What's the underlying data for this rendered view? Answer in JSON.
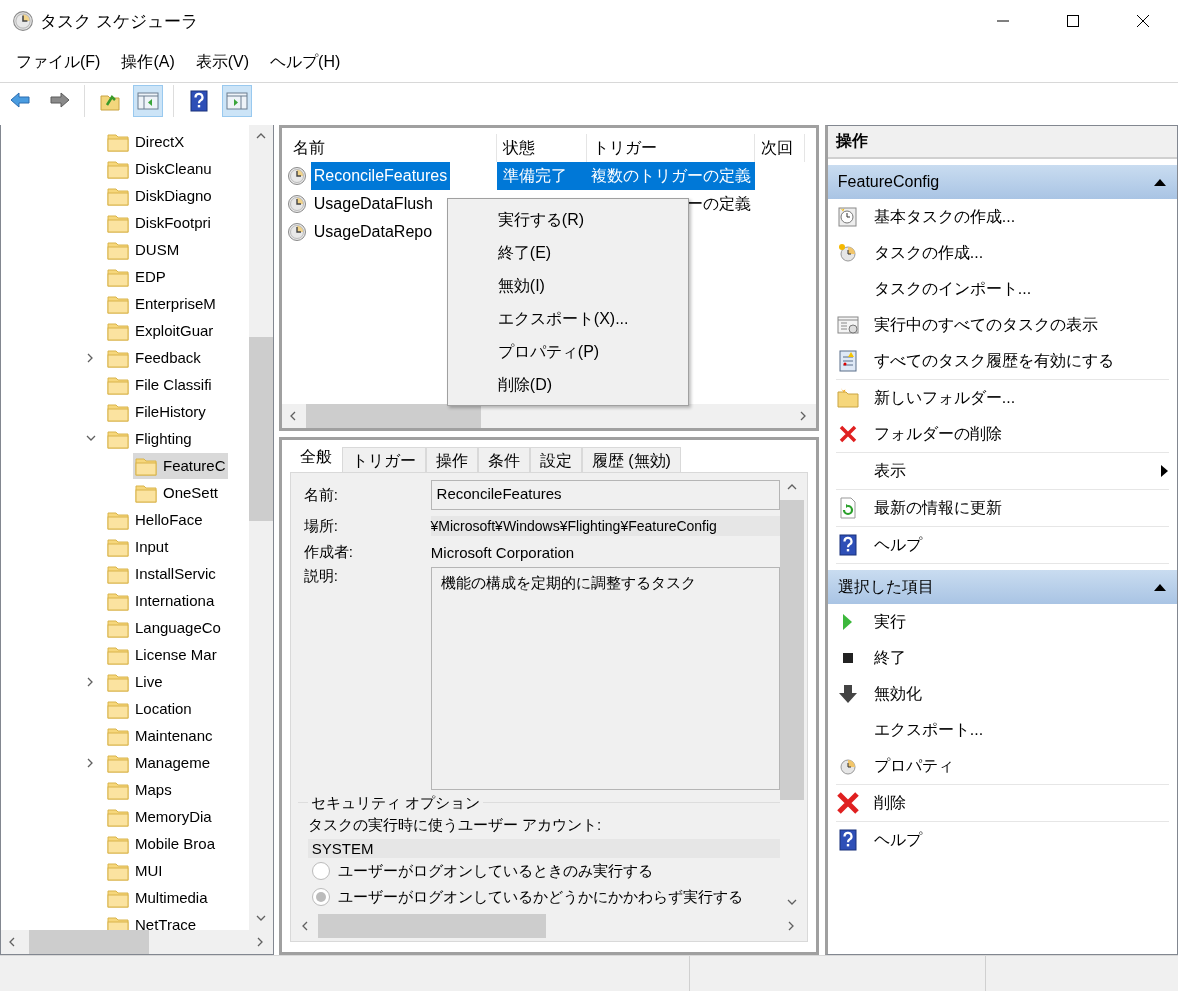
{
  "window": {
    "title": "タスク スケジューラ"
  },
  "menu": [
    "ファイル(F)",
    "操作(A)",
    "表示(V)",
    "ヘルプ(H)"
  ],
  "toolbar": [
    [
      {
        "kind": "back",
        "pressed": false
      },
      {
        "kind": "forward",
        "pressed": false
      }
    ],
    [
      {
        "kind": "up",
        "pressed": false
      },
      {
        "kind": "tree",
        "pressed": true
      }
    ],
    [
      {
        "kind": "help",
        "pressed": false
      },
      {
        "kind": "actions",
        "pressed": true
      }
    ]
  ],
  "tree": [
    {
      "label": "DirectX",
      "expandable": false,
      "expanded": false,
      "selected": false
    },
    {
      "label": "DiskCleanu",
      "expandable": false,
      "expanded": false,
      "selected": false
    },
    {
      "label": "DiskDiagno",
      "expandable": false,
      "expanded": false,
      "selected": false
    },
    {
      "label": "DiskFootpri",
      "expandable": false,
      "expanded": false,
      "selected": false
    },
    {
      "label": "DUSM",
      "expandable": false,
      "expanded": false,
      "selected": false
    },
    {
      "label": "EDP",
      "expandable": false,
      "expanded": false,
      "selected": false
    },
    {
      "label": "EnterpriseM",
      "expandable": false,
      "expanded": false,
      "selected": false
    },
    {
      "label": "ExploitGuar",
      "expandable": false,
      "expanded": false,
      "selected": false
    },
    {
      "label": "Feedback",
      "expandable": true,
      "expanded": false,
      "selected": false
    },
    {
      "label": "File Classifi",
      "expandable": false,
      "expanded": false,
      "selected": false
    },
    {
      "label": "FileHistory",
      "expandable": false,
      "expanded": false,
      "selected": false
    },
    {
      "label": "Flighting",
      "expandable": true,
      "expanded": true,
      "selected": false,
      "children": [
        {
          "label": "FeatureC",
          "expandable": false,
          "expanded": false,
          "selected": true
        },
        {
          "label": "OneSett",
          "expandable": false,
          "expanded": false,
          "selected": false
        }
      ]
    },
    {
      "label": "HelloFace",
      "expandable": false,
      "expanded": false,
      "selected": false
    },
    {
      "label": "Input",
      "expandable": false,
      "expanded": false,
      "selected": false
    },
    {
      "label": "InstallServic",
      "expandable": false,
      "expanded": false,
      "selected": false
    },
    {
      "label": "Internationa",
      "expandable": false,
      "expanded": false,
      "selected": false
    },
    {
      "label": "LanguageCo",
      "expandable": false,
      "expanded": false,
      "selected": false
    },
    {
      "label": "License Mar",
      "expandable": false,
      "expanded": false,
      "selected": false
    },
    {
      "label": "Live",
      "expandable": true,
      "expanded": false,
      "selected": false
    },
    {
      "label": "Location",
      "expandable": false,
      "expanded": false,
      "selected": false
    },
    {
      "label": "Maintenanc",
      "expandable": false,
      "expanded": false,
      "selected": false
    },
    {
      "label": "Manageme",
      "expandable": true,
      "expanded": false,
      "selected": false
    },
    {
      "label": "Maps",
      "expandable": false,
      "expanded": false,
      "selected": false
    },
    {
      "label": "MemoryDia",
      "expandable": false,
      "expanded": false,
      "selected": false
    },
    {
      "label": "Mobile Broa",
      "expandable": false,
      "expanded": false,
      "selected": false
    },
    {
      "label": "MUI",
      "expandable": false,
      "expanded": false,
      "selected": false
    },
    {
      "label": "Multimedia",
      "expandable": false,
      "expanded": false,
      "selected": false
    },
    {
      "label": "NetTrace",
      "expandable": false,
      "expanded": false,
      "selected": false
    }
  ],
  "task_list": {
    "columns": [
      "名前",
      "状態",
      "トリガー",
      "次回"
    ],
    "rows": [
      {
        "name": "ReconcileFeatures",
        "status": "準備完了",
        "trigger": "複数のトリガーの定義",
        "selected": true
      },
      {
        "name": "UsageDataFlush",
        "trigger": "ーの定義",
        "selected": false
      },
      {
        "name": "UsageDataRepo",
        "selected": false
      }
    ]
  },
  "context_menu": [
    "実行する(R)",
    "終了(E)",
    "無効(I)",
    "エクスポート(X)...",
    "プロパティ(P)",
    "削除(D)"
  ],
  "details": {
    "tabs": [
      {
        "label": "全般",
        "selected": true
      },
      {
        "label": "トリガー",
        "selected": false
      },
      {
        "label": "操作",
        "selected": false
      },
      {
        "label": "条件",
        "selected": false
      },
      {
        "label": "設定",
        "selected": false
      },
      {
        "label": "履歴 (無効)",
        "selected": false
      }
    ],
    "name_label": "名前:",
    "name": "ReconcileFeatures",
    "location_label": "場所:",
    "location": "¥Microsoft¥Windows¥Flighting¥FeatureConfig",
    "author_label": "作成者:",
    "author": "Microsoft Corporation",
    "description_label": "説明:",
    "description": "機能の構成を定期的に調整するタスク",
    "security": {
      "title": "セキュリティ オプション",
      "account_label": "タスクの実行時に使うユーザー アカウント:",
      "account": "SYSTEM",
      "options": [
        {
          "label": "ユーザーがログオンしているときのみ実行する",
          "selected": false
        },
        {
          "label": "ユーザーがログオンしているかどうかにかかわらず実行する",
          "selected": true
        }
      ]
    }
  },
  "actions": {
    "title": "操作",
    "sections": [
      {
        "title": "FeatureConfig",
        "expanded": true,
        "groups": [
          [
            {
              "label": "基本タスクの作成...",
              "kind": "basic-task"
            },
            {
              "label": "タスクの作成...",
              "kind": "task"
            },
            {
              "label": "タスクのインポート...",
              "kind": "plain"
            },
            {
              "label": "実行中のすべてのタスクの表示",
              "kind": "running"
            },
            {
              "label": "すべてのタスク履歴を有効にする",
              "kind": "history"
            }
          ],
          [
            {
              "label": "新しいフォルダー...",
              "kind": "new-folder"
            },
            {
              "label": "フォルダーの削除",
              "kind": "delete-small"
            }
          ],
          [
            {
              "label": "表示",
              "kind": "submenu"
            }
          ],
          [
            {
              "label": "最新の情報に更新",
              "kind": "refresh"
            }
          ],
          [
            {
              "label": "ヘルプ",
              "kind": "help"
            }
          ]
        ]
      },
      {
        "title": "選択した項目",
        "expanded": true,
        "groups": [
          [
            {
              "label": "実行",
              "kind": "run"
            },
            {
              "label": "終了",
              "kind": "stop"
            },
            {
              "label": "無効化",
              "kind": "disable"
            },
            {
              "label": "エクスポート...",
              "kind": "plain"
            },
            {
              "label": "プロパティ",
              "kind": "properties"
            }
          ],
          [
            {
              "label": "削除",
              "kind": "delete"
            }
          ],
          [
            {
              "label": "ヘルプ",
              "kind": "help"
            }
          ]
        ]
      }
    ]
  }
}
